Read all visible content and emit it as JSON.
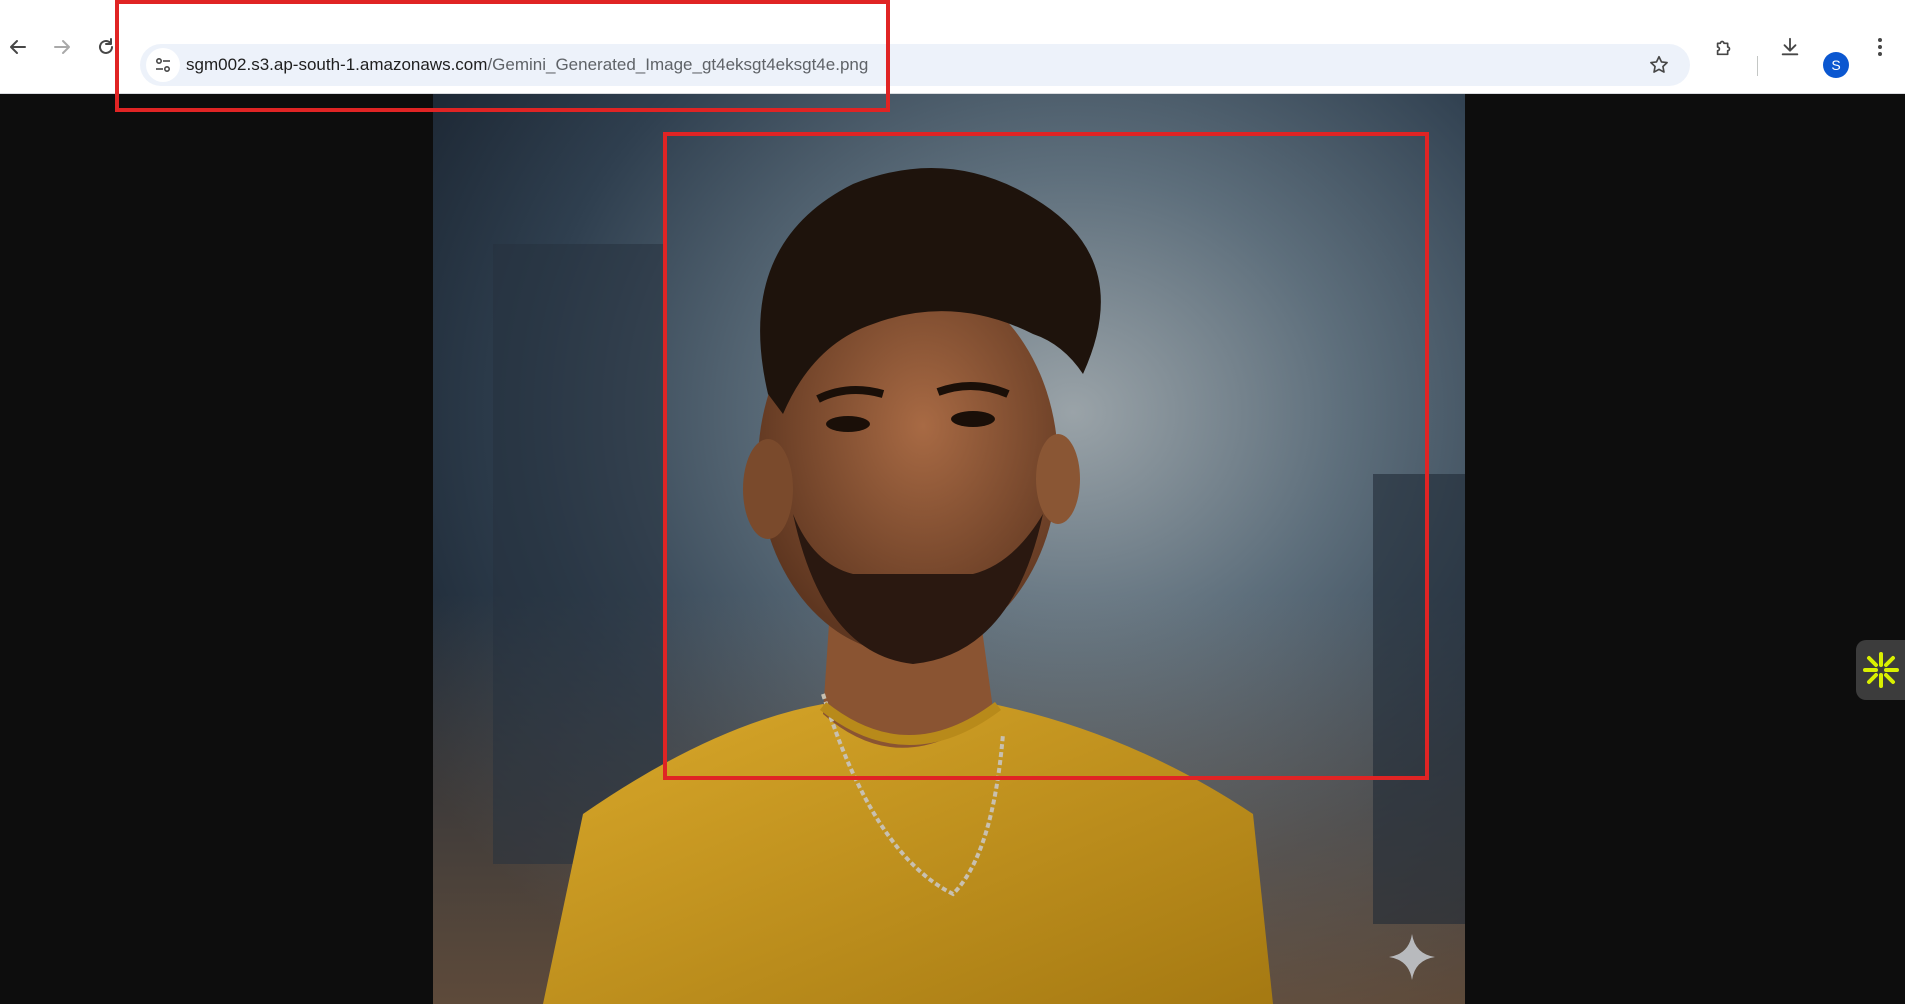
{
  "browser": {
    "url_host": "sgm002.s3.ap-south-1.amazonaws.com",
    "url_path": "/Gemini_Generated_Image_gt4eksgt4eksgt4e.png",
    "profile_initial": "S",
    "icons": {
      "back": "arrow-left-icon",
      "forward": "arrow-right-icon",
      "reload": "reload-icon",
      "site_info": "tune-icon",
      "bookmark": "star-icon",
      "extensions": "puzzle-icon",
      "downloads": "download-icon",
      "menu": "kebab-menu-icon"
    },
    "colors": {
      "accent": "#0b57d0",
      "omnibox": "#edf2fa",
      "annotation": "#e02424"
    }
  },
  "image": {
    "description_icon": "portrait-photo",
    "watermark_icon": "sparkle-icon"
  },
  "side_widget": {
    "icon": "asterisk-burst-icon",
    "color": "#d9f000"
  }
}
